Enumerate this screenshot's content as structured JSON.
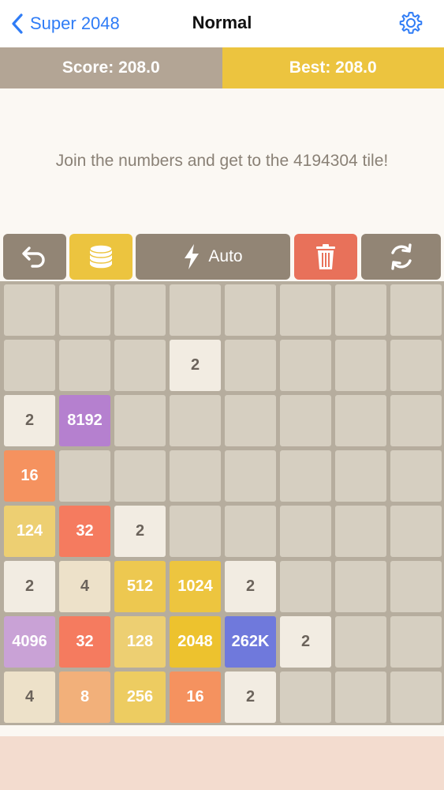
{
  "nav": {
    "back_label": "Super 2048",
    "title": "Normal",
    "back_icon": "chevron-left-icon",
    "settings_icon": "gear-icon"
  },
  "scorebar": {
    "score_label": "Score: 208.0",
    "best_label": "Best: 208.0"
  },
  "message": "Join the numbers and get to the 4194304 tile!",
  "toolbar": {
    "undo_icon": "undo-icon",
    "coins_icon": "coins-icon",
    "auto_label": "Auto",
    "auto_icon": "lightning-icon",
    "trash_icon": "trash-icon",
    "restart_icon": "refresh-icon"
  },
  "colors": {
    "accent_blue": "#2f7cf6",
    "score_bg": "#b3a595",
    "best_bg": "#ecc43f",
    "board_bg": "#b6ad9e",
    "empty_cell": "#d6cfc1",
    "trash_button": "#e8715a",
    "coins_button": "#ecc43f",
    "tool_button": "#928575"
  },
  "board": {
    "rows": 8,
    "cols": 8,
    "tiles": [
      [
        "",
        "",
        "",
        "",
        "",
        "",
        "",
        ""
      ],
      [
        "",
        "",
        "",
        "2",
        "",
        "",
        "",
        ""
      ],
      [
        "2",
        "8192",
        "",
        "",
        "",
        "",
        "",
        ""
      ],
      [
        "16",
        "",
        "",
        "",
        "",
        "",
        "",
        ""
      ],
      [
        "124",
        "32",
        "2",
        "",
        "",
        "",
        "",
        ""
      ],
      [
        "2",
        "4",
        "512",
        "1024",
        "2",
        "",
        "",
        ""
      ],
      [
        "4096",
        "32",
        "128",
        "2048",
        "262K",
        "2",
        "",
        ""
      ],
      [
        "4",
        "8",
        "256",
        "16",
        "2",
        "",
        "",
        ""
      ]
    ],
    "tile_colors": {
      "2": {
        "bg": "#f2ece2",
        "fg": "#6b635b"
      },
      "4": {
        "bg": "#ede1c9",
        "fg": "#6b635b"
      },
      "8": {
        "bg": "#f2b07a",
        "fg": "#ffffff"
      },
      "16": {
        "bg": "#f5925f",
        "fg": "#ffffff"
      },
      "32": {
        "bg": "#f57b5f",
        "fg": "#ffffff"
      },
      "124": {
        "bg": "#edcf72",
        "fg": "#ffffff"
      },
      "128": {
        "bg": "#edcf72",
        "fg": "#ffffff"
      },
      "256": {
        "bg": "#edcc61",
        "fg": "#ffffff"
      },
      "512": {
        "bg": "#edc850",
        "fg": "#ffffff"
      },
      "1024": {
        "bg": "#edc53f",
        "fg": "#ffffff"
      },
      "2048": {
        "bg": "#edc22e",
        "fg": "#ffffff"
      },
      "4096": {
        "bg": "#c9a2d6",
        "fg": "#ffffff"
      },
      "8192": {
        "bg": "#b580cf",
        "fg": "#ffffff"
      },
      "262K": {
        "bg": "#6f79dc",
        "fg": "#ffffff"
      }
    }
  }
}
